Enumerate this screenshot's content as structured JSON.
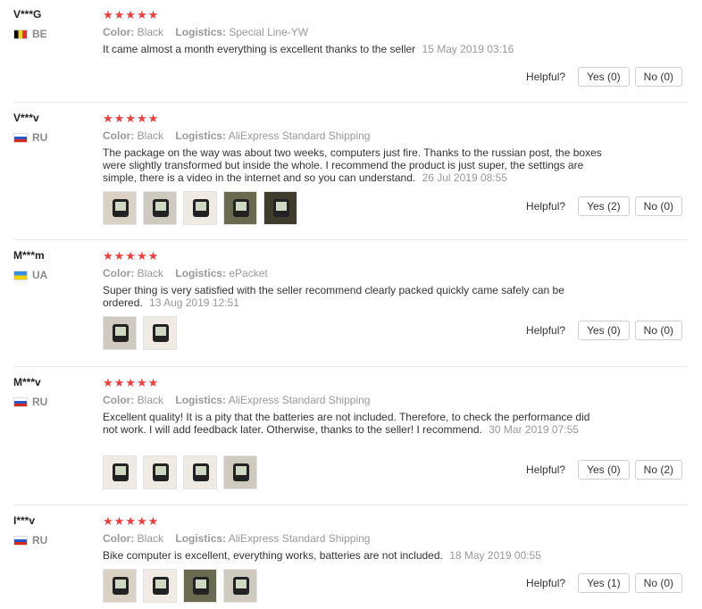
{
  "helpful_label": "Helpful?",
  "meta_labels": {
    "color": "Color:",
    "logistics": "Logistics:"
  },
  "reviews": [
    {
      "user": "V***G",
      "country": "BE",
      "flag": "be",
      "stars": "★★★★★",
      "color": "Black",
      "logistics": "Special Line-YW",
      "text": "It came almost a month everything is excellent thanks to the seller",
      "date": "15 May 2019 03:16",
      "yes": "Yes (0)",
      "no": "No (0)",
      "photos": []
    },
    {
      "user": "V***v",
      "country": "RU",
      "flag": "ru",
      "stars": "★★★★★",
      "color": "Black",
      "logistics": "AliExpress Standard Shipping",
      "text": "The package on the way was about two weeks, computers just fire. Thanks to the russian post, the boxes were slightly transformed but inside the whole. I recommend the product is just super, the settings are simple, there is a video in the internet and so you can understand.",
      "date": "26 Jul 2019 08:55",
      "yes": "Yes (2)",
      "no": "No (0)",
      "photos": [
        "p1",
        "p2",
        "p3",
        "p4",
        "p5"
      ]
    },
    {
      "user": "M***m",
      "country": "UA",
      "flag": "ua",
      "stars": "★★★★★",
      "color": "Black",
      "logistics": "ePacket",
      "text": "Super thing is very satisfied with the seller recommend clearly packed quickly came safely can be ordered.",
      "date": "13 Aug 2019 12:51",
      "yes": "Yes (0)",
      "no": "No (0)",
      "photos": [
        "p2",
        "p3"
      ]
    },
    {
      "user": "M***v",
      "country": "RU",
      "flag": "ru",
      "stars": "★★★★★",
      "color": "Black",
      "logistics": "AliExpress Standard Shipping",
      "text": "Excellent quality! It is a pity that the batteries are not included. Therefore, to check the performance did not work. I will add feedback later. Otherwise, thanks to the seller! I recommend.",
      "date": "30 Mar 2019 07:55",
      "yes": "Yes (0)",
      "no": "No (2)",
      "photos": [
        "p3",
        "p3",
        "p3",
        "p2"
      ]
    },
    {
      "user": "I***v",
      "country": "RU",
      "flag": "ru",
      "stars": "★★★★★",
      "color": "Black",
      "logistics": "AliExpress Standard Shipping",
      "text": "Bike computer is excellent, everything works, batteries are not included.",
      "date": "18 May 2019 00:55",
      "yes": "Yes (1)",
      "no": "No (0)",
      "photos": [
        "p1",
        "p3",
        "p4",
        "p2"
      ]
    }
  ]
}
